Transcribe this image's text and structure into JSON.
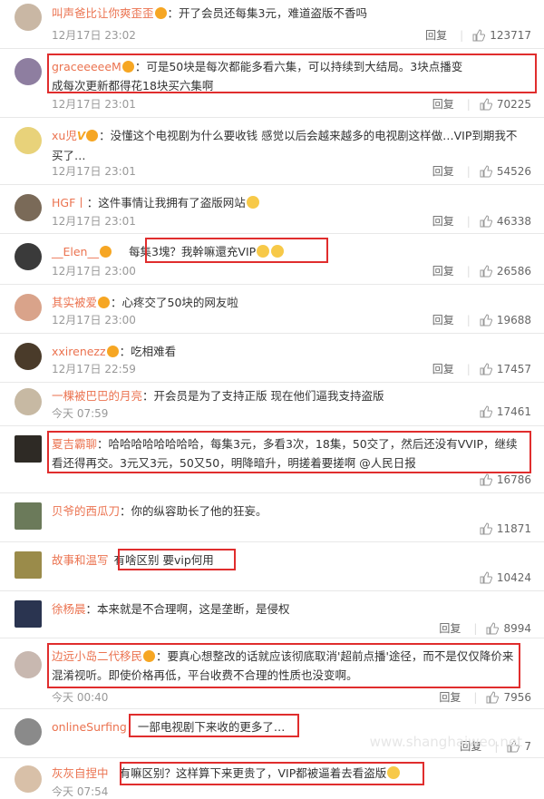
{
  "comments": [
    {
      "user": "叫声爸比让你爽歪歪",
      "text": "：开了会员还每集3元，难道盗版不香吗",
      "time": "12月17日 23:02",
      "reply": "回复",
      "likes": "123717",
      "avatar": "#c9b7a4"
    },
    {
      "user": "graceeeeeM",
      "text": "：可是50块是每次都能多看六集，可以持续到大结局。3块点播变成每次更新都得花18块买六集啊",
      "time": "12月17日 23:01",
      "reply": "回复",
      "likes": "70225",
      "avatar": "#8e7ea0"
    },
    {
      "user": "xu児",
      "text": "：没懂这个电视剧为什么要收钱 感觉以后会越来越多的电视剧这样做…VIP到期我不买了…",
      "time": "12月17日 23:01",
      "reply": "回复",
      "likes": "54526",
      "avatar": "#e8d27a"
    },
    {
      "user": "HGF丨",
      "text": "：这件事情让我拥有了盗版网站",
      "time": "12月17日 23:01",
      "reply": "回复",
      "likes": "46338",
      "avatar": "#7a6a58"
    },
    {
      "user": "__Elen__",
      "text": "每集3塊？我幹嘛還充VIP",
      "time": "12月17日 23:00",
      "reply": "回复",
      "likes": "26586",
      "avatar": "#3a3a3a"
    },
    {
      "user": "其实被爱",
      "text": "：心疼交了50块的网友啦",
      "time": "12月17日 23:00",
      "reply": "回复",
      "likes": "19688",
      "avatar": "#d9a38a"
    },
    {
      "user": "xxirenezz",
      "text": "：吃相难看",
      "time": "12月17日 22:59",
      "reply": "回复",
      "likes": "17457",
      "avatar": "#4a3b2a"
    },
    {
      "user": "一棵被巴巴的月亮",
      "text": "：开会员是为了支持正版 现在他们逼我支持盗版",
      "time": "今天 07:59",
      "reply": "",
      "likes": "17461",
      "avatar": "#c7b9a3"
    },
    {
      "user": "夏吉霸聊",
      "text": "：哈哈哈哈哈哈哈哈，每集3元，多看3次，18集，50交了，然后还没有VVIP，继续看还得再交。3元又3元，50又50，明降暗升，明搓着要搓啊 @人民日报",
      "time": "",
      "reply": "",
      "likes": "16786",
      "avatar": "#2e2a25"
    },
    {
      "user": "贝爷的西瓜刀",
      "text": "：你的纵容助长了他的狂妄。",
      "time": "",
      "reply": "",
      "likes": "11871",
      "avatar": "#6b7a5a"
    },
    {
      "user": "故事和温写",
      "text": "有啥区别 要vip何用",
      "time": "",
      "reply": "",
      "likes": "10424",
      "avatar": "#9a8b4a"
    },
    {
      "user": "徐杨晨",
      "text": "：本来就是不合理啊，这是垄断，是侵权",
      "time": "",
      "reply": "回复",
      "likes": "8994",
      "avatar": "#2a3450"
    },
    {
      "user": "边远小岛二代移民",
      "text": "：要真心想整改的话就应该彻底取消'超前点播'途径，而不是仅仅降价来混淆视听。即使价格再低，平台收费不合理的性质也没变啊。",
      "time": "今天 00:40",
      "reply": "回复",
      "likes": "7956",
      "avatar": "#c8b8b0"
    },
    {
      "user": "onlineSurfing",
      "text": "一部电视剧下来收的更多了…",
      "time": "",
      "reply": "回复",
      "likes": "7",
      "avatar": "#8a8a8a"
    },
    {
      "user": "灰灰自捏中",
      "text": "有嘛区别？这样算下来更贵了，VIP都被逼着去看盗版",
      "time": "今天 07:54",
      "reply": "",
      "likes": "",
      "avatar": "#d8c0a8"
    }
  ],
  "watermark": "www.shanghaiweo.net",
  "colors": {
    "username": "#eb7350",
    "highlight": "#e02d2d",
    "meta": "#999999"
  }
}
